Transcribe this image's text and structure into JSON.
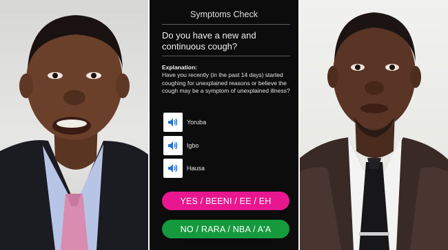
{
  "screen": {
    "title": "Symptoms Check",
    "question": "Do you have a new and continuous cough?",
    "explanation_label": "Explanation:",
    "explanation_text": "Have you recently (in the past 14 days) started coughing for unexplained reasons or believe the cough may be a symptom of unexplained illness?",
    "languages": [
      {
        "label": "Yoruba",
        "icon": "speaker-icon"
      },
      {
        "label": "Igbo",
        "icon": "speaker-icon"
      },
      {
        "label": "Hausa",
        "icon": "speaker-icon"
      }
    ],
    "yes_label": "YES / BEENI / EE / EH",
    "no_label": "NO / RARA / NBA / A'A"
  },
  "colors": {
    "screen_bg": "#0c0c0c",
    "yes_button": "#e8178f",
    "no_button": "#149a3c",
    "speaker_icon": "#1e73d8"
  }
}
